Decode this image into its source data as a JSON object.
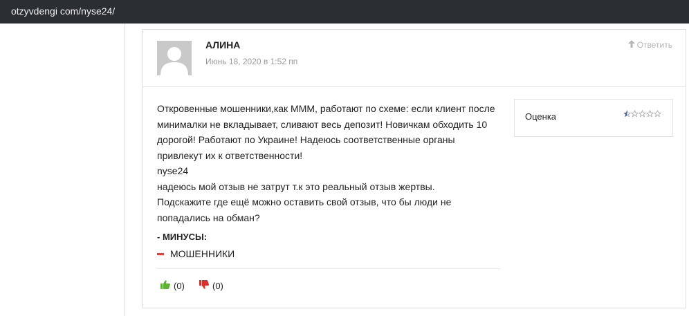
{
  "browser": {
    "url": "otzyvdengi com/nyse24/"
  },
  "review": {
    "author": "АЛИНА",
    "date": "Июнь 18, 2020 в 1:52 пп",
    "reply_label": "Ответить",
    "body_lines": [
      "Откровенные мошенники,как МММ, работают по схеме: если клиент после",
      "минималки не вкладывает, сливают весь депозит! Новичкам обходить 10",
      "дорогой! Работают по Украине! Надеюсь соответственные органы",
      "привлекут их к ответственности!",
      "nyse24",
      "надеюсь мой отзыв не затрут т.к это реальный отзыв жертвы.",
      "Подскажите где ещё можно оставить свой отзыв, что бы люди не",
      "попадались на обман?"
    ],
    "minus_title": "- МИНУСЫ:",
    "minus_items": [
      "МОШЕННИКИ"
    ],
    "votes": {
      "up": "(0)",
      "down": "(0)"
    },
    "rating": {
      "label": "Оценка",
      "value": 0.5,
      "max": 5
    }
  },
  "colors": {
    "topbar": "#2b2e33",
    "minus_accent": "#e0413a",
    "thumb_up": "#5cb531",
    "thumb_down": "#d9302c",
    "star": "#4a5bb8"
  },
  "icons": {
    "avatar": "default-avatar-icon",
    "reply": "arrow-up-icon",
    "vote_up": "thumbs-up-icon",
    "vote_down": "thumbs-down-icon",
    "star": "star-icon"
  }
}
